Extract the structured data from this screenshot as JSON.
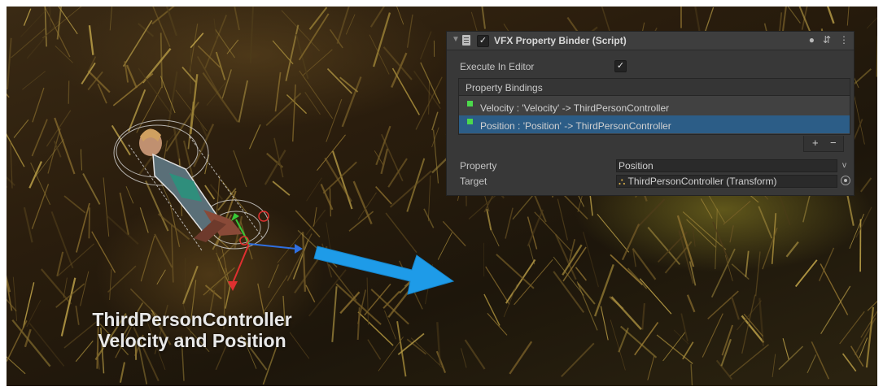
{
  "inspector": {
    "component_title": "VFX Property Binder (Script)",
    "component_enabled": true,
    "header_icons": [
      "help-icon",
      "preset-icon",
      "more-menu-icon"
    ],
    "execute_in_editor_label": "Execute In Editor",
    "execute_in_editor_checked": true,
    "property_bindings_label": "Property Bindings",
    "bindings": [
      {
        "label": "Velocity : 'Velocity' -> ThirdPersonController",
        "selected": false
      },
      {
        "label": "Position : 'Position' -> ThirdPersonController",
        "selected": true
      }
    ],
    "add_label": "+",
    "remove_label": "−",
    "property_label": "Property",
    "property_value": "Position",
    "property_dropdown_glyph": "v",
    "target_label": "Target",
    "target_value": "ThirdPersonController (Transform)",
    "target_icon": "transform-icon"
  },
  "overlay": {
    "line1": "ThirdPersonController",
    "line2": "Velocity and Position"
  },
  "colors": {
    "panel_bg": "#383838",
    "selected_row": "#2c5d87",
    "binding_marker": "#4cd94c",
    "arrow": "#1e9be8"
  }
}
